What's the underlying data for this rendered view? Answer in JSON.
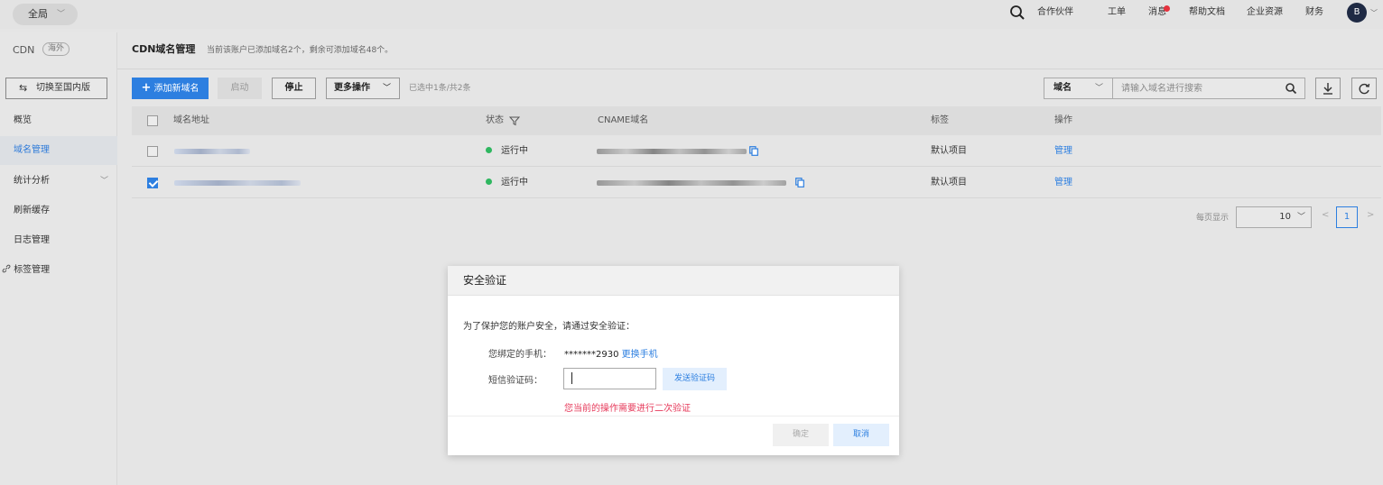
{
  "topbar": {
    "region": "全局",
    "nav": [
      "合作伙伴",
      "工单",
      "消息",
      "帮助文档",
      "企业资源",
      "财务"
    ],
    "avatar": "B"
  },
  "sidebar": {
    "title": "CDN",
    "tag": "海外",
    "switch_label": "切换至国内版",
    "items": [
      "概览",
      "域名管理",
      "统计分析",
      "刷新缓存",
      "日志管理",
      "标签管理"
    ]
  },
  "page": {
    "title": "CDN域名管理",
    "subtitle": "当前该账户已添加域名2个，剩余可添加域名48个。"
  },
  "toolbar": {
    "add": "添加新域名",
    "start": "启动",
    "stop": "停止",
    "more": "更多操作",
    "selection": "已选中1条/共2条",
    "search_type": "域名",
    "search_placeholder": "请输入域名进行搜索"
  },
  "table": {
    "headers": [
      "域名地址",
      "状态",
      "CNAME域名",
      "标签",
      "操作"
    ],
    "rows": [
      {
        "status": "运行中",
        "tag": "默认项目",
        "action": "管理",
        "checked": false
      },
      {
        "status": "运行中",
        "tag": "默认项目",
        "action": "管理",
        "checked": true
      }
    ]
  },
  "pager": {
    "label": "每页显示",
    "page_size": "10",
    "prev": "<",
    "current": "1",
    "next": ">"
  },
  "modal": {
    "title": "安全验证",
    "intro": "为了保护您的账户安全，请通过安全验证：",
    "phone_label": "您绑定的手机：",
    "phone": "*******2930",
    "change_phone": "更换手机",
    "code_label": "短信验证码：",
    "code_value": "",
    "send_code": "发送验证码",
    "error": "您当前的操作需要进行二次验证",
    "ok": "确定",
    "cancel": "取消"
  },
  "colors": {
    "accent": "#2d7fe0",
    "running": "#2fb760",
    "error": "#e6395a",
    "badge": "#e5323e"
  }
}
